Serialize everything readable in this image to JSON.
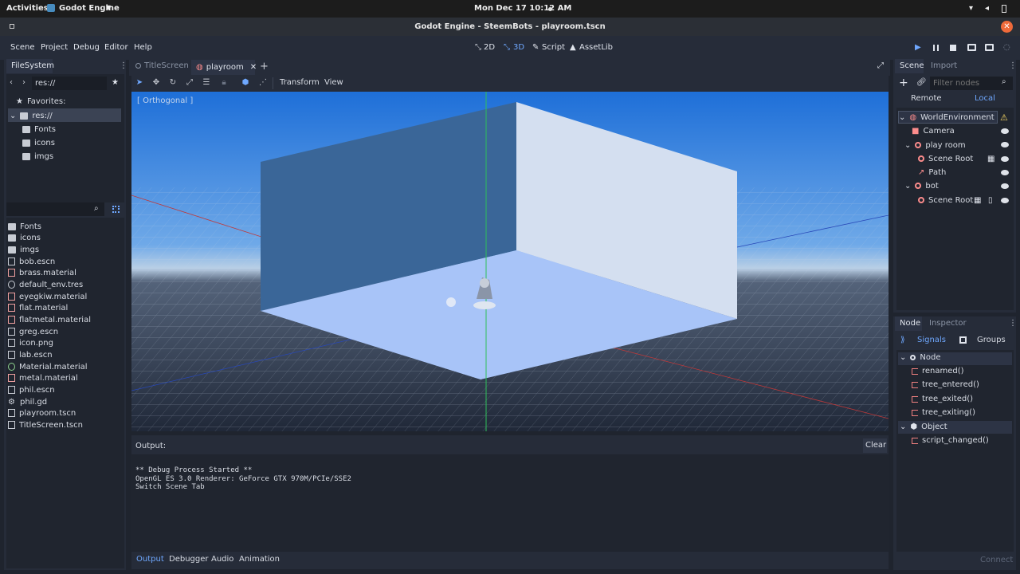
{
  "os_bar": {
    "activities": "Activities",
    "app": "Godot Engine",
    "clock": "Mon Dec 17  10:12 AM"
  },
  "window": {
    "title": "Godot Engine - SteemBots - playroom.tscn"
  },
  "menu": {
    "items": [
      "Scene",
      "Project",
      "Debug",
      "Editor",
      "Help"
    ]
  },
  "workspaces": {
    "mode_2d": "2D",
    "mode_3d": "3D",
    "script": "Script",
    "assetlib": "AssetLib"
  },
  "filesystem": {
    "tab": "FileSystem",
    "path": "res://",
    "favorites": "Favorites:",
    "root": "res://",
    "tree": [
      "Fonts",
      "icons",
      "imgs"
    ],
    "files": [
      "Fonts",
      "icons",
      "imgs",
      "bob.escn",
      "brass.material",
      "default_env.tres",
      "eyegkiw.material",
      "flat.material",
      "flatmetal.material",
      "greg.escn",
      "icon.png",
      "lab.escn",
      "Material.material",
      "metal.material",
      "phil.escn",
      "phil.gd",
      "playroom.tscn",
      "TitleScreen.tscn"
    ]
  },
  "editor_tabs": {
    "tab1": "TitleScreen",
    "tab2": "playroom"
  },
  "toolbar": {
    "transform": "Transform",
    "view": "View"
  },
  "viewport": {
    "label": "[ Orthogonal ]"
  },
  "scene_dock": {
    "tab_scene": "Scene",
    "tab_import": "Import",
    "filter_placeholder": "Filter nodes",
    "remote": "Remote",
    "local": "Local",
    "nodes": {
      "n0": "WorldEnvironment",
      "n1": "Camera",
      "n2": "play room",
      "n3": "Scene Root",
      "n4": "Path",
      "n5": "bot",
      "n6": "Scene Root"
    }
  },
  "node_dock": {
    "tab_node": "Node",
    "tab_inspector": "Inspector",
    "signals": "Signals",
    "groups": "Groups",
    "node_class": "Node",
    "object_class": "Object",
    "sig": {
      "s0": "renamed()",
      "s1": "tree_entered()",
      "s2": "tree_exited()",
      "s3": "tree_exiting()",
      "s4": "script_changed()"
    },
    "connect": "Connect"
  },
  "output": {
    "label": "Output:",
    "clear": "Clear",
    "text": "** Debug Process Started **\nOpenGL ES 3.0 Renderer: GeForce GTX 970M/PCIe/SSE2\nSwitch Scene Tab"
  },
  "bottom_tabs": {
    "output": "Output",
    "debugger": "Debugger",
    "audio": "Audio",
    "animation": "Animation"
  },
  "colors": {
    "accent": "#6fa8ff",
    "close": "#ef6a3a",
    "warning": "#ffdd65",
    "node_icon": "#fc8c8c"
  }
}
